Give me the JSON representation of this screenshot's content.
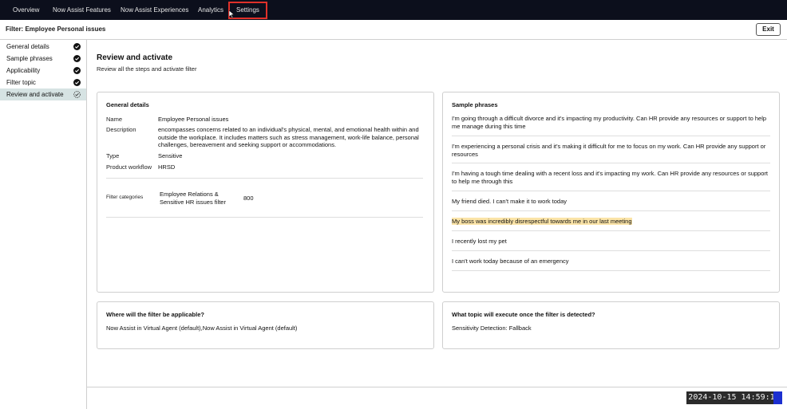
{
  "nav": {
    "tabs": [
      {
        "label": "Overview"
      },
      {
        "label": "Now Assist Features"
      },
      {
        "label": "Now Assist Experiences"
      },
      {
        "label": "Analytics"
      },
      {
        "label": "Settings"
      }
    ]
  },
  "header": {
    "title": "Filter: Employee Personal issues",
    "exit_label": "Exit"
  },
  "sidebar": {
    "items": [
      {
        "label": "General details",
        "icon": "check-circle-icon"
      },
      {
        "label": "Sample phrases",
        "icon": "check-circle-icon"
      },
      {
        "label": "Applicability",
        "icon": "check-circle-icon"
      },
      {
        "label": "Filter topic",
        "icon": "check-circle-icon"
      },
      {
        "label": "Review and activate",
        "icon": "dashed-check-circle-icon"
      }
    ]
  },
  "main": {
    "title": "Review and activate",
    "subtitle": "Review all the steps and activate filter"
  },
  "general": {
    "title": "General details",
    "name_label": "Name",
    "name_value": "Employee Personal issues",
    "description_label": "Description",
    "description_value": "encompasses concerns related to an individual's physical, mental, and emotional health within and outside the workplace. It includes matters such as stress management, work-life balance, personal challenges, bereavement and seeking support or accommodations.",
    "type_label": "Type",
    "type_value": "Sensitive",
    "workflow_label": "Product workflow",
    "workflow_value": "HRSD",
    "categories_label": "Filter categories",
    "category_name": "Employee Relations & Sensitive HR issues filter",
    "category_value": "800"
  },
  "phrases": {
    "title": "Sample phrases",
    "items": [
      "I'm going through a difficult divorce and it's impacting my productivity. Can HR provide any resources or support to help me manage during this time",
      "I'm experiencing a personal crisis and it's making it difficult for me to focus on my work. Can HR provide any support or resources",
      "I'm having a tough time dealing with a recent loss and it's impacting my work. Can HR provide any resources or support to help me through this",
      "My friend died. I can't make it to work today",
      "My boss was incredibly disrespectful towards me in our last meeting",
      "I recently lost my pet",
      "I can't work today because of an emergency"
    ]
  },
  "applicable": {
    "title": "Where will the filter be applicable?",
    "value": "Now Assist in Virtual Agent (default),Now Assist in Virtual Agent (default)"
  },
  "topic": {
    "title": "What topic will execute once the filter is detected?",
    "value": "Sensitivity Detection: Fallback"
  },
  "timestamp": "2024-10-15 14:59:12",
  "colors": {
    "nav_bg": "#0c0f1c",
    "highlight": "#fbe4a8",
    "selected_sidebar": "#d6e3e3",
    "annotation_red": "#e0312a"
  }
}
